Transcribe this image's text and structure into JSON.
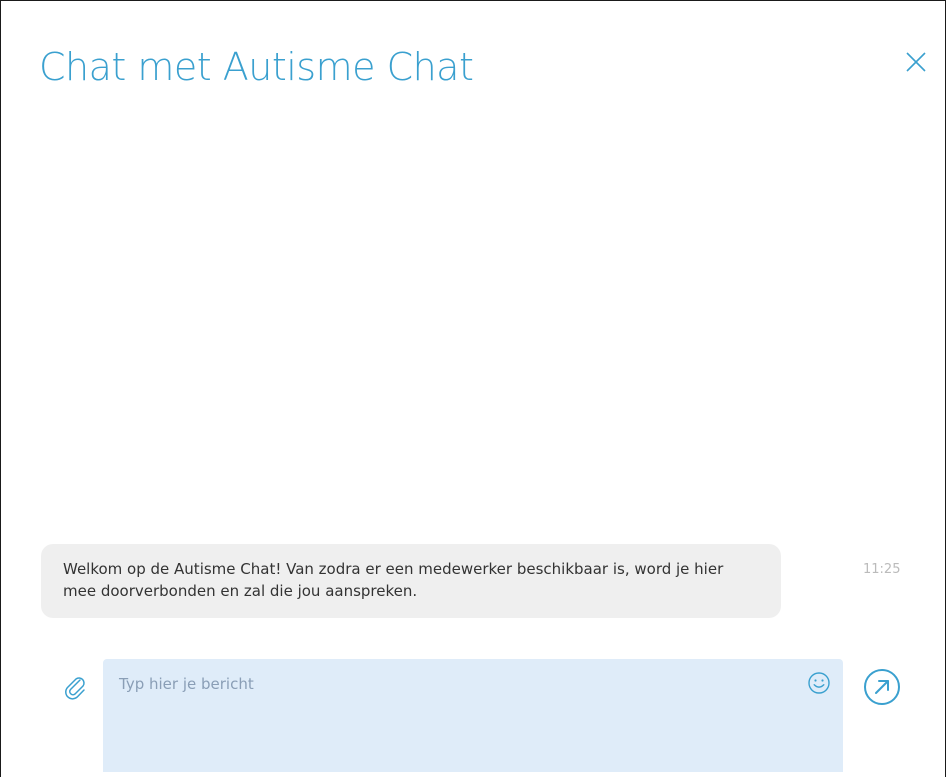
{
  "header": {
    "title": "Chat met Autisme Chat",
    "close_icon": "close-icon"
  },
  "messages": [
    {
      "text": "Welkom op de Autisme Chat! Van zodra er een medewerker beschikbaar is, word je hier mee doorverbonden en zal die jou aanspreken.",
      "time": "11:25"
    }
  ],
  "composer": {
    "placeholder": "Typ hier je bericht",
    "attach_icon": "paperclip-icon",
    "emoji_icon": "smiley-icon",
    "send_icon": "send-arrow-icon"
  },
  "colors": {
    "accent": "#3aa0cf",
    "message_bg": "#efefef",
    "input_bg": "#dfecf9",
    "timestamp": "#bbbbbb"
  }
}
